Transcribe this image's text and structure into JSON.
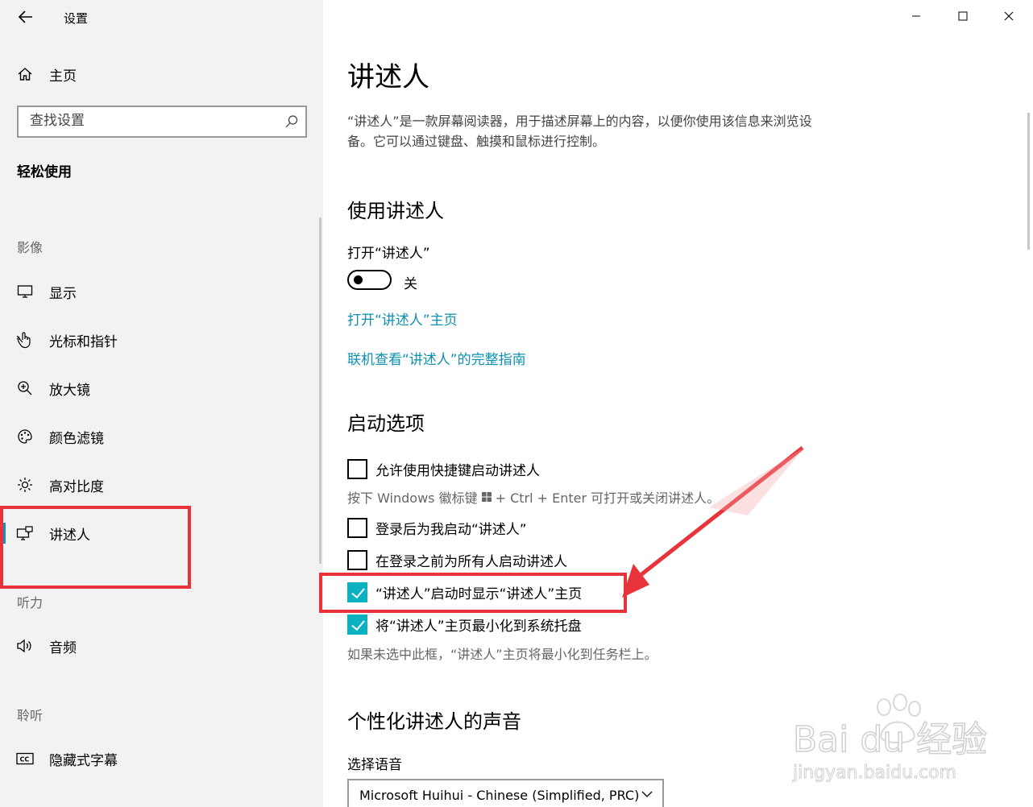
{
  "app": {
    "title": "设置"
  },
  "sidebar": {
    "home_label": "主页",
    "search_placeholder": "查找设置",
    "section_title": "轻松使用",
    "groups": {
      "vision": "影像",
      "hearing": "听力",
      "listen": "聆听"
    },
    "items": {
      "display": "显示",
      "cursor": "光标和指针",
      "magnifier": "放大镜",
      "color_filter": "颜色滤镜",
      "high_contrast": "高对比度",
      "narrator": "讲述人",
      "audio": "音频",
      "captions": "隐藏式字幕"
    }
  },
  "main": {
    "title": "讲述人",
    "description": "“讲述人”是一款屏幕阅读器，用于描述屏幕上的内容，以便你使用该信息来浏览设备。它可以通过键盘、触摸和鼠标进行控制。",
    "use_section": {
      "heading": "使用讲述人",
      "toggle_label": "打开“讲述人”",
      "toggle_state": "关",
      "link_home": "打开“讲述人”主页",
      "link_guide": "联机查看“讲述人”的完整指南"
    },
    "startup_section": {
      "heading": "启动选项",
      "cb_shortcut": "允许使用快捷键启动讲述人",
      "shortcut_hint_prefix": "按下 Windows 徽标键",
      "shortcut_hint_suffix": "+ Ctrl + Enter 可打开或关闭讲述人。",
      "cb_after_signin": "登录后为我启动“讲述人”",
      "cb_before_signin": "在登录之前为所有人启动讲述人",
      "cb_show_home": "“讲述人”启动时显示“讲述人”主页",
      "cb_minimize": "将“讲述人”主页最小化到系统托盘",
      "minimize_hint": "如果未选中此框，“讲述人”主页将最小化到任务栏上。"
    },
    "voice_section": {
      "heading": "个性化讲述人的声音",
      "select_label": "选择语音",
      "selected_voice": "Microsoft Huihui - Chinese (Simplified, PRC)"
    }
  },
  "watermark": {
    "brand": "Bai du 经验",
    "url": "jingyan.baidu.com"
  },
  "colors": {
    "accent": "#0ab1c1",
    "link": "#0e8fb0",
    "annotation": "#e8333a"
  }
}
